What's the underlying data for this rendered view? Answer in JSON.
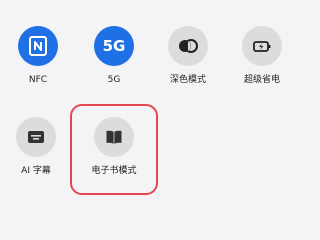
{
  "tiles": {
    "nfc": {
      "label": "NFC",
      "icon": "nfc-icon",
      "state": "on"
    },
    "fiveg": {
      "label": "5G",
      "icon_text": "5G",
      "state": "on"
    },
    "dark_mode": {
      "label": "深色模式",
      "icon": "dark-mode-icon",
      "state": "off"
    },
    "super_saver": {
      "label": "超级省电",
      "icon": "battery-saver-icon",
      "state": "off"
    },
    "ai_subtitles": {
      "label": "AI 字幕",
      "icon": "subtitles-icon",
      "state": "off"
    },
    "ebook_mode": {
      "label": "电子书模式",
      "icon": "book-icon",
      "state": "off"
    }
  },
  "colors": {
    "active": "#1f6fe5",
    "inactive": "#dcdcdf",
    "highlight": "#e3474f"
  }
}
